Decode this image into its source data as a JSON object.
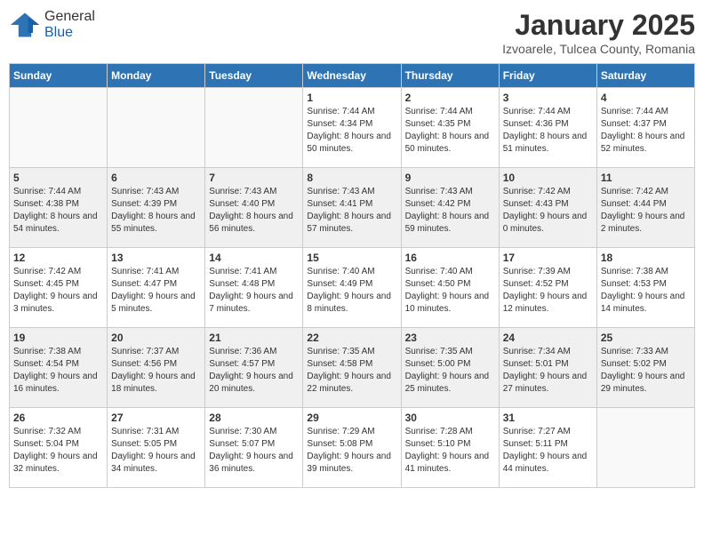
{
  "header": {
    "logo_general": "General",
    "logo_blue": "Blue",
    "month_title": "January 2025",
    "subtitle": "Izvoarele, Tulcea County, Romania"
  },
  "weekdays": [
    "Sunday",
    "Monday",
    "Tuesday",
    "Wednesday",
    "Thursday",
    "Friday",
    "Saturday"
  ],
  "weeks": [
    [
      {
        "day": "",
        "empty": true
      },
      {
        "day": "",
        "empty": true
      },
      {
        "day": "",
        "empty": true
      },
      {
        "day": "1",
        "sunrise": "7:44 AM",
        "sunset": "4:34 PM",
        "daylight": "8 hours and 50 minutes."
      },
      {
        "day": "2",
        "sunrise": "7:44 AM",
        "sunset": "4:35 PM",
        "daylight": "8 hours and 50 minutes."
      },
      {
        "day": "3",
        "sunrise": "7:44 AM",
        "sunset": "4:36 PM",
        "daylight": "8 hours and 51 minutes."
      },
      {
        "day": "4",
        "sunrise": "7:44 AM",
        "sunset": "4:37 PM",
        "daylight": "8 hours and 52 minutes."
      }
    ],
    [
      {
        "day": "5",
        "sunrise": "7:44 AM",
        "sunset": "4:38 PM",
        "daylight": "8 hours and 54 minutes."
      },
      {
        "day": "6",
        "sunrise": "7:43 AM",
        "sunset": "4:39 PM",
        "daylight": "8 hours and 55 minutes."
      },
      {
        "day": "7",
        "sunrise": "7:43 AM",
        "sunset": "4:40 PM",
        "daylight": "8 hours and 56 minutes."
      },
      {
        "day": "8",
        "sunrise": "7:43 AM",
        "sunset": "4:41 PM",
        "daylight": "8 hours and 57 minutes."
      },
      {
        "day": "9",
        "sunrise": "7:43 AM",
        "sunset": "4:42 PM",
        "daylight": "8 hours and 59 minutes."
      },
      {
        "day": "10",
        "sunrise": "7:42 AM",
        "sunset": "4:43 PM",
        "daylight": "9 hours and 0 minutes."
      },
      {
        "day": "11",
        "sunrise": "7:42 AM",
        "sunset": "4:44 PM",
        "daylight": "9 hours and 2 minutes."
      }
    ],
    [
      {
        "day": "12",
        "sunrise": "7:42 AM",
        "sunset": "4:45 PM",
        "daylight": "9 hours and 3 minutes."
      },
      {
        "day": "13",
        "sunrise": "7:41 AM",
        "sunset": "4:47 PM",
        "daylight": "9 hours and 5 minutes."
      },
      {
        "day": "14",
        "sunrise": "7:41 AM",
        "sunset": "4:48 PM",
        "daylight": "9 hours and 7 minutes."
      },
      {
        "day": "15",
        "sunrise": "7:40 AM",
        "sunset": "4:49 PM",
        "daylight": "9 hours and 8 minutes."
      },
      {
        "day": "16",
        "sunrise": "7:40 AM",
        "sunset": "4:50 PM",
        "daylight": "9 hours and 10 minutes."
      },
      {
        "day": "17",
        "sunrise": "7:39 AM",
        "sunset": "4:52 PM",
        "daylight": "9 hours and 12 minutes."
      },
      {
        "day": "18",
        "sunrise": "7:38 AM",
        "sunset": "4:53 PM",
        "daylight": "9 hours and 14 minutes."
      }
    ],
    [
      {
        "day": "19",
        "sunrise": "7:38 AM",
        "sunset": "4:54 PM",
        "daylight": "9 hours and 16 minutes."
      },
      {
        "day": "20",
        "sunrise": "7:37 AM",
        "sunset": "4:56 PM",
        "daylight": "9 hours and 18 minutes."
      },
      {
        "day": "21",
        "sunrise": "7:36 AM",
        "sunset": "4:57 PM",
        "daylight": "9 hours and 20 minutes."
      },
      {
        "day": "22",
        "sunrise": "7:35 AM",
        "sunset": "4:58 PM",
        "daylight": "9 hours and 22 minutes."
      },
      {
        "day": "23",
        "sunrise": "7:35 AM",
        "sunset": "5:00 PM",
        "daylight": "9 hours and 25 minutes."
      },
      {
        "day": "24",
        "sunrise": "7:34 AM",
        "sunset": "5:01 PM",
        "daylight": "9 hours and 27 minutes."
      },
      {
        "day": "25",
        "sunrise": "7:33 AM",
        "sunset": "5:02 PM",
        "daylight": "9 hours and 29 minutes."
      }
    ],
    [
      {
        "day": "26",
        "sunrise": "7:32 AM",
        "sunset": "5:04 PM",
        "daylight": "9 hours and 32 minutes."
      },
      {
        "day": "27",
        "sunrise": "7:31 AM",
        "sunset": "5:05 PM",
        "daylight": "9 hours and 34 minutes."
      },
      {
        "day": "28",
        "sunrise": "7:30 AM",
        "sunset": "5:07 PM",
        "daylight": "9 hours and 36 minutes."
      },
      {
        "day": "29",
        "sunrise": "7:29 AM",
        "sunset": "5:08 PM",
        "daylight": "9 hours and 39 minutes."
      },
      {
        "day": "30",
        "sunrise": "7:28 AM",
        "sunset": "5:10 PM",
        "daylight": "9 hours and 41 minutes."
      },
      {
        "day": "31",
        "sunrise": "7:27 AM",
        "sunset": "5:11 PM",
        "daylight": "9 hours and 44 minutes."
      },
      {
        "day": "",
        "empty": true
      }
    ]
  ]
}
